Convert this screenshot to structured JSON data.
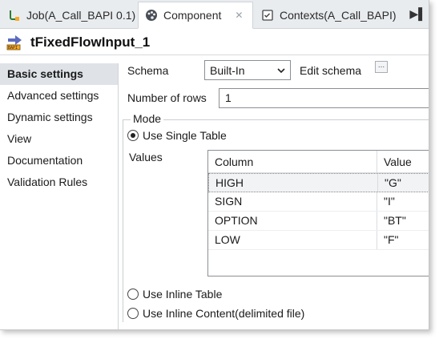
{
  "tabs": [
    {
      "label": "Job(A_Call_BAPI 0.1)",
      "icon": "job-icon",
      "active": false
    },
    {
      "label": "Component",
      "icon": "palette-icon",
      "active": true,
      "closable": true
    },
    {
      "label": "Contexts(A_Call_BAPI)",
      "icon": "contexts-icon",
      "active": false
    }
  ],
  "tabs_overflow_icon": "tab-overflow-icon",
  "component_title": "tFixedFlowInput_1",
  "sidebar": {
    "items": [
      {
        "label": "Basic settings",
        "active": true
      },
      {
        "label": "Advanced settings"
      },
      {
        "label": "Dynamic settings"
      },
      {
        "label": "View"
      },
      {
        "label": "Documentation"
      },
      {
        "label": "Validation Rules"
      }
    ]
  },
  "settings": {
    "schema_label": "Schema",
    "schema_value": "Built-In",
    "edit_schema_label": "Edit schema",
    "edit_schema_button": "...",
    "rows_label": "Number of rows",
    "rows_value": "1",
    "mode_label": "Mode",
    "mode_single": "Use Single Table",
    "values_label": "Values",
    "mode_inline_table": "Use Inline Table",
    "mode_inline_content": "Use Inline Content(delimited file)",
    "selected_mode": "single"
  },
  "values_table": {
    "headers": [
      "Column",
      "Value"
    ],
    "rows": [
      [
        "HIGH",
        "\"G\""
      ],
      [
        "SIGN",
        "\"I\""
      ],
      [
        "OPTION",
        "\"BT\""
      ],
      [
        "LOW",
        "\"F\""
      ]
    ]
  },
  "colors": {
    "tab_bar": "#e9ecef",
    "active_nav": "#dfe3e8",
    "border": "#8a8f95"
  }
}
